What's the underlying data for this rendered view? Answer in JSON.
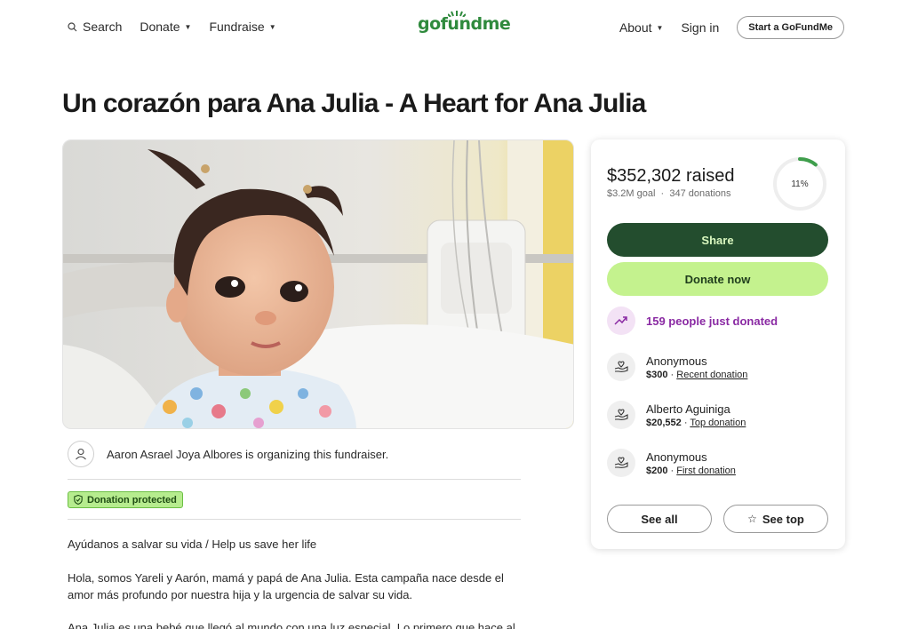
{
  "header": {
    "search_label": "Search",
    "donate_label": "Donate",
    "fundraise_label": "Fundraise",
    "logo_text": "gofundme",
    "about_label": "About",
    "signin_label": "Sign in",
    "start_label": "Start a GoFundMe"
  },
  "campaign": {
    "title": "Un corazón para Ana Julia - A Heart for Ana Julia",
    "organizer_text": "Aaron Asrael Joya Albores is organizing this fundraiser.",
    "protected_label": "Donation protected",
    "story": [
      "Ayúdanos a salvar su vida / Help us save her life",
      "Hola, somos Yareli y Aarón, mamá y papá de Ana Julia. Esta campaña nace desde el amor más profundo por nuestra hija y la urgencia de salvar su vida.",
      "Ana Julia es una bebé que llegó al mundo con una luz especial. Lo primero que hace al"
    ]
  },
  "donation_card": {
    "raised": "$352,302 raised",
    "goal": "$3.2M goal",
    "donations": "347 donations",
    "percent_label": "11%",
    "percent_value": 0.11,
    "share_label": "Share",
    "donate_label": "Donate now",
    "recent_activity": "159 people just donated",
    "donors": [
      {
        "name": "Anonymous",
        "amount": "$300",
        "tag": "Recent donation"
      },
      {
        "name": "Alberto Aguiniga",
        "amount": "$20,552",
        "tag": "Top donation"
      },
      {
        "name": "Anonymous",
        "amount": "$200",
        "tag": "First donation"
      }
    ],
    "see_all_label": "See all",
    "see_top_label": "See top"
  },
  "colors": {
    "brand_green": "#2f8a3d",
    "share_bg": "#234d2e",
    "donate_bg": "#c4f28e",
    "trend_purple": "#8a2aa3",
    "protected_bg": "#b6ec8e"
  }
}
